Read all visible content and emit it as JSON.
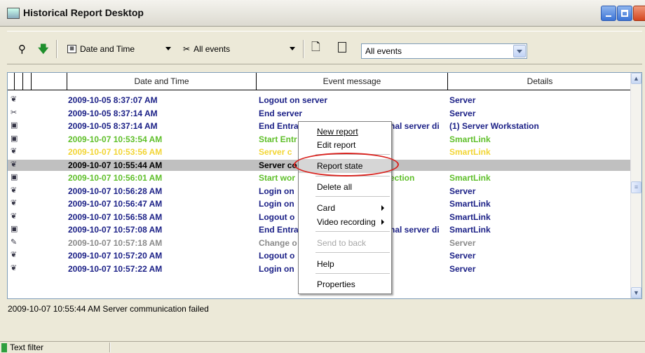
{
  "window": {
    "title": "Historical Report Desktop"
  },
  "toolbar": {
    "date_time_label": "Date and Time",
    "all_events_label": "All events",
    "combo_value": "All events"
  },
  "columns": [
    "Date and Time",
    "Event message",
    "Details"
  ],
  "rows": [
    {
      "datetime": "2009-10-05 8:37:07 AM",
      "message": "Logout on server",
      "details": "Server",
      "color": "#1a1f86",
      "icon": "❦"
    },
    {
      "datetime": "2009-10-05 8:37:14 AM",
      "message": "End server",
      "details": "Server",
      "color": "#1a1f86",
      "icon": "✂"
    },
    {
      "datetime": "2009-10-05 8:37:14 AM",
      "message": "End Entra",
      "msg_right": "nal server di",
      "details": "(1) Server Workstation",
      "color": "#1a1f86",
      "icon": "▣"
    },
    {
      "datetime": "2009-10-07 10:53:54 AM",
      "message": "Start Entr",
      "details": "SmartLink",
      "color": "#5fbf2a",
      "icon": "▣"
    },
    {
      "datetime": "2009-10-07 10:53:56 AM",
      "message": "Server c",
      "details": "SmartLink",
      "color": "#f2d534",
      "icon": "❦"
    },
    {
      "datetime": "2009-10-07 10:55:44 AM",
      "message": "Server co",
      "details": "",
      "color": "#000000",
      "icon": "❦",
      "selected": true
    },
    {
      "datetime": "2009-10-07 10:56:01 AM",
      "message": "Start wor",
      "msg_right": "ection",
      "details": "SmartLink",
      "color": "#5fbf2a",
      "icon": "▣"
    },
    {
      "datetime": "2009-10-07 10:56:28 AM",
      "message": "Login on",
      "details": "Server",
      "color": "#1a1f86",
      "icon": "❦"
    },
    {
      "datetime": "2009-10-07 10:56:47 AM",
      "message": "Login on",
      "details": "SmartLink",
      "color": "#1a1f86",
      "icon": "❦"
    },
    {
      "datetime": "2009-10-07 10:56:58 AM",
      "message": "Logout o",
      "details": "SmartLink",
      "color": "#1a1f86",
      "icon": "❦"
    },
    {
      "datetime": "2009-10-07 10:57:08 AM",
      "message": "End Entra",
      "msg_right": "nal server di",
      "details": "SmartLink",
      "color": "#1a1f86",
      "icon": "▣"
    },
    {
      "datetime": "2009-10-07 10:57:18 AM",
      "message": "Change o",
      "details": "Server",
      "color": "#8a8a8a",
      "icon": "✎"
    },
    {
      "datetime": "2009-10-07 10:57:20 AM",
      "message": "Logout o",
      "details": "Server",
      "color": "#1a1f86",
      "icon": "❦"
    },
    {
      "datetime": "2009-10-07 10:57:22 AM",
      "message": "Login on",
      "details": "Server",
      "color": "#1a1f86",
      "icon": "❦"
    }
  ],
  "status": {
    "text": "2009-10-07 10:55:44 AM  Server communication failed"
  },
  "filter": {
    "label": "Text filter"
  },
  "context_menu": {
    "items": [
      {
        "label": "New report"
      },
      {
        "label": "Edit report"
      },
      {
        "label": "Report state"
      },
      {
        "label": "Delete all"
      },
      {
        "label": "Card"
      },
      {
        "label": "Video recording"
      },
      {
        "label": "Send to back"
      },
      {
        "label": "Help"
      },
      {
        "label": "Properties"
      }
    ]
  }
}
